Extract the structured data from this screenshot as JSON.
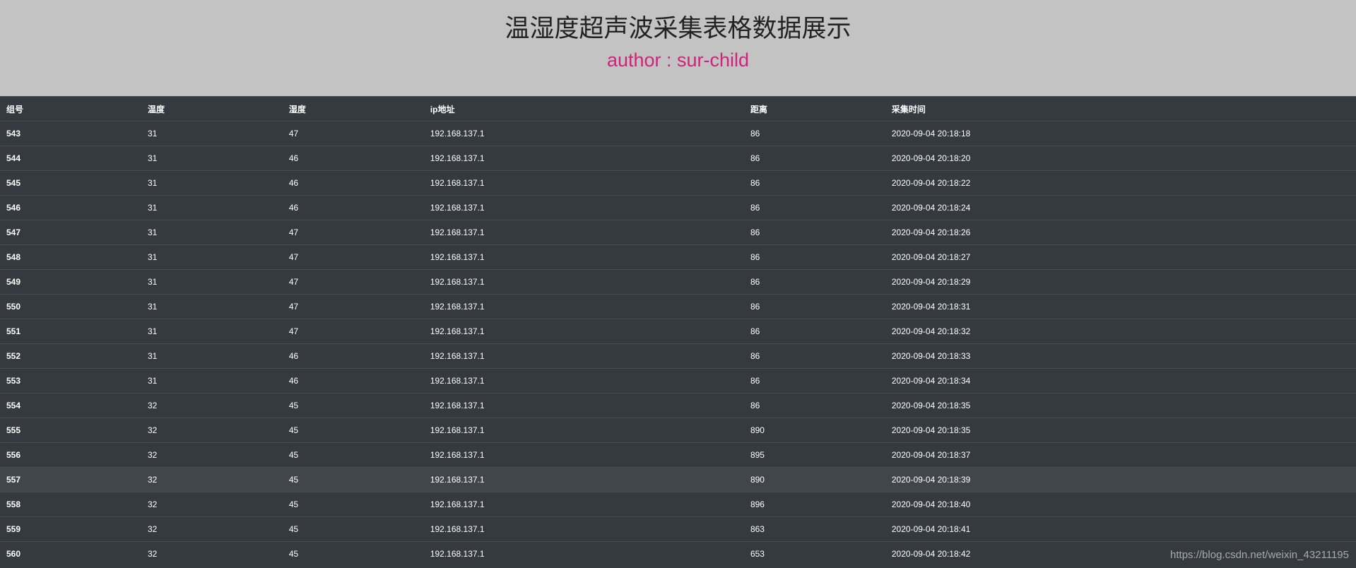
{
  "header": {
    "title": "温湿度超声波采集表格数据展示",
    "author": "author : sur-child"
  },
  "table": {
    "columns": [
      "组号",
      "温度",
      "湿度",
      "ip地址",
      "距离",
      "采集时间"
    ],
    "rows": [
      [
        "543",
        "31",
        "47",
        "192.168.137.1",
        "86",
        "2020-09-04 20:18:18"
      ],
      [
        "544",
        "31",
        "46",
        "192.168.137.1",
        "86",
        "2020-09-04 20:18:20"
      ],
      [
        "545",
        "31",
        "46",
        "192.168.137.1",
        "86",
        "2020-09-04 20:18:22"
      ],
      [
        "546",
        "31",
        "46",
        "192.168.137.1",
        "86",
        "2020-09-04 20:18:24"
      ],
      [
        "547",
        "31",
        "47",
        "192.168.137.1",
        "86",
        "2020-09-04 20:18:26"
      ],
      [
        "548",
        "31",
        "47",
        "192.168.137.1",
        "86",
        "2020-09-04 20:18:27"
      ],
      [
        "549",
        "31",
        "47",
        "192.168.137.1",
        "86",
        "2020-09-04 20:18:29"
      ],
      [
        "550",
        "31",
        "47",
        "192.168.137.1",
        "86",
        "2020-09-04 20:18:31"
      ],
      [
        "551",
        "31",
        "47",
        "192.168.137.1",
        "86",
        "2020-09-04 20:18:32"
      ],
      [
        "552",
        "31",
        "46",
        "192.168.137.1",
        "86",
        "2020-09-04 20:18:33"
      ],
      [
        "553",
        "31",
        "46",
        "192.168.137.1",
        "86",
        "2020-09-04 20:18:34"
      ],
      [
        "554",
        "32",
        "45",
        "192.168.137.1",
        "86",
        "2020-09-04 20:18:35"
      ],
      [
        "555",
        "32",
        "45",
        "192.168.137.1",
        "890",
        "2020-09-04 20:18:35"
      ],
      [
        "556",
        "32",
        "45",
        "192.168.137.1",
        "895",
        "2020-09-04 20:18:37"
      ],
      [
        "557",
        "32",
        "45",
        "192.168.137.1",
        "890",
        "2020-09-04 20:18:39"
      ],
      [
        "558",
        "32",
        "45",
        "192.168.137.1",
        "896",
        "2020-09-04 20:18:40"
      ],
      [
        "559",
        "32",
        "45",
        "192.168.137.1",
        "863",
        "2020-09-04 20:18:41"
      ],
      [
        "560",
        "32",
        "45",
        "192.168.137.1",
        "653",
        "2020-09-04 20:18:42"
      ]
    ],
    "hovered_row": "557"
  },
  "watermark": "https://blog.csdn.net/weixin_43211195",
  "colors": {
    "header_bg": "#c3c3c3",
    "author": "#d0227a",
    "table_bg": "#343a40",
    "row_hover": "#41464b"
  }
}
